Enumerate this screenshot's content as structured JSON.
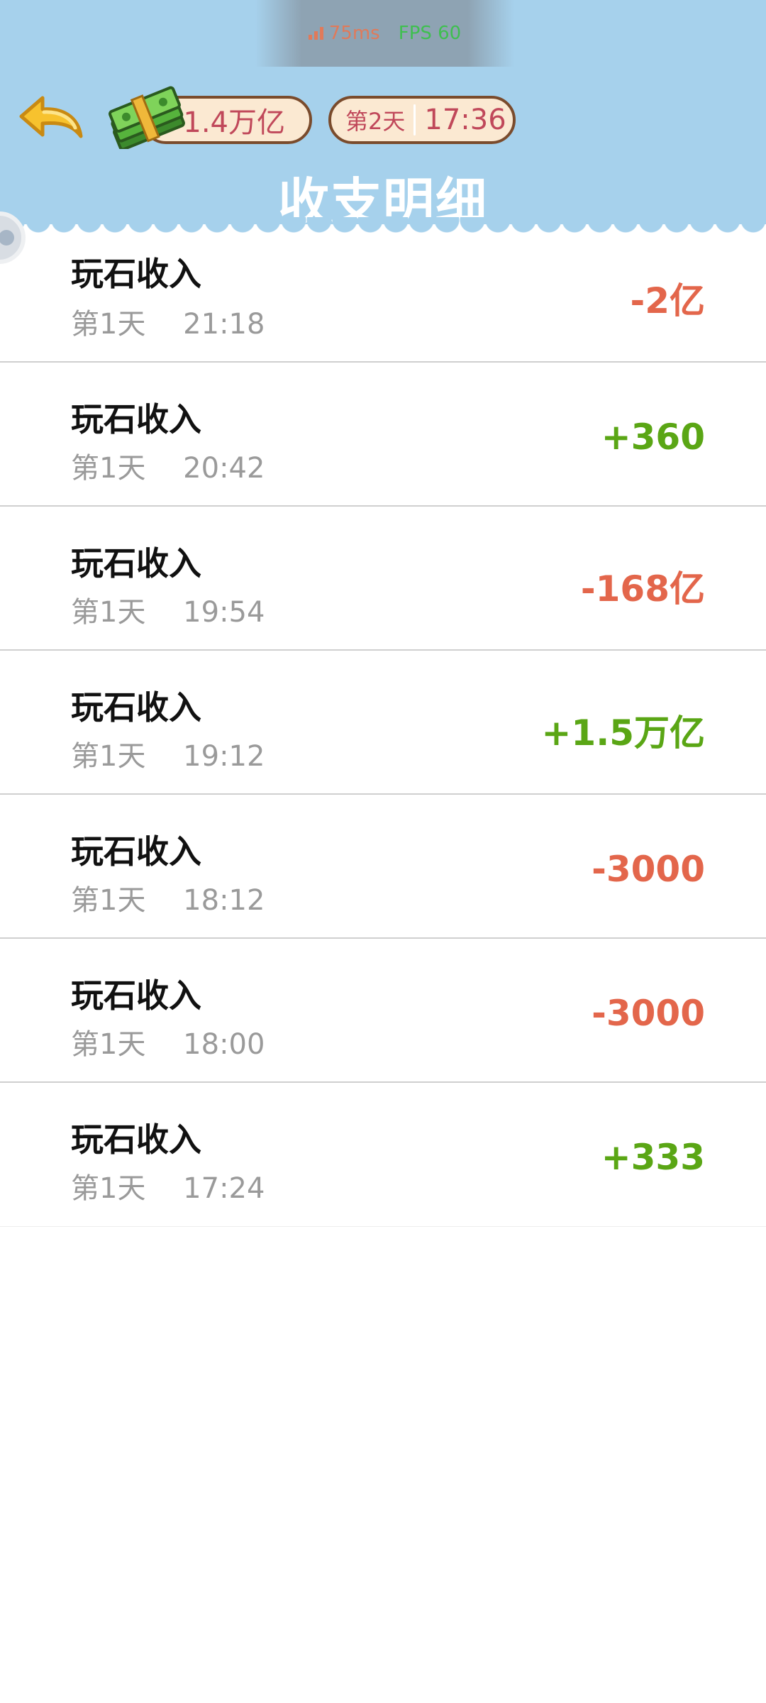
{
  "status": {
    "ping": "75ms",
    "fps": "FPS 60"
  },
  "header": {
    "money": "1.4万亿",
    "day": "第2天",
    "time": "17:36",
    "title": "收支明细"
  },
  "colors": {
    "header_bg": "#a6d1ec",
    "pill_bg": "#fbe9d2",
    "pill_text": "#c0485a",
    "negative": "#e3664b",
    "positive": "#5aa615"
  },
  "transactions": [
    {
      "title": "玩石收入",
      "day": "第1天",
      "time": "21:18",
      "amount": "-2亿",
      "sign": "negative"
    },
    {
      "title": "玩石收入",
      "day": "第1天",
      "time": "20:42",
      "amount": "+360",
      "sign": "positive"
    },
    {
      "title": "玩石收入",
      "day": "第1天",
      "time": "19:54",
      "amount": "-168亿",
      "sign": "negative"
    },
    {
      "title": "玩石收入",
      "day": "第1天",
      "time": "19:12",
      "amount": "+1.5万亿",
      "sign": "positive"
    },
    {
      "title": "玩石收入",
      "day": "第1天",
      "time": "18:12",
      "amount": "-3000",
      "sign": "negative"
    },
    {
      "title": "玩石收入",
      "day": "第1天",
      "time": "18:00",
      "amount": "-3000",
      "sign": "negative"
    },
    {
      "title": "玩石收入",
      "day": "第1天",
      "time": "17:24",
      "amount": "+333",
      "sign": "positive"
    }
  ]
}
